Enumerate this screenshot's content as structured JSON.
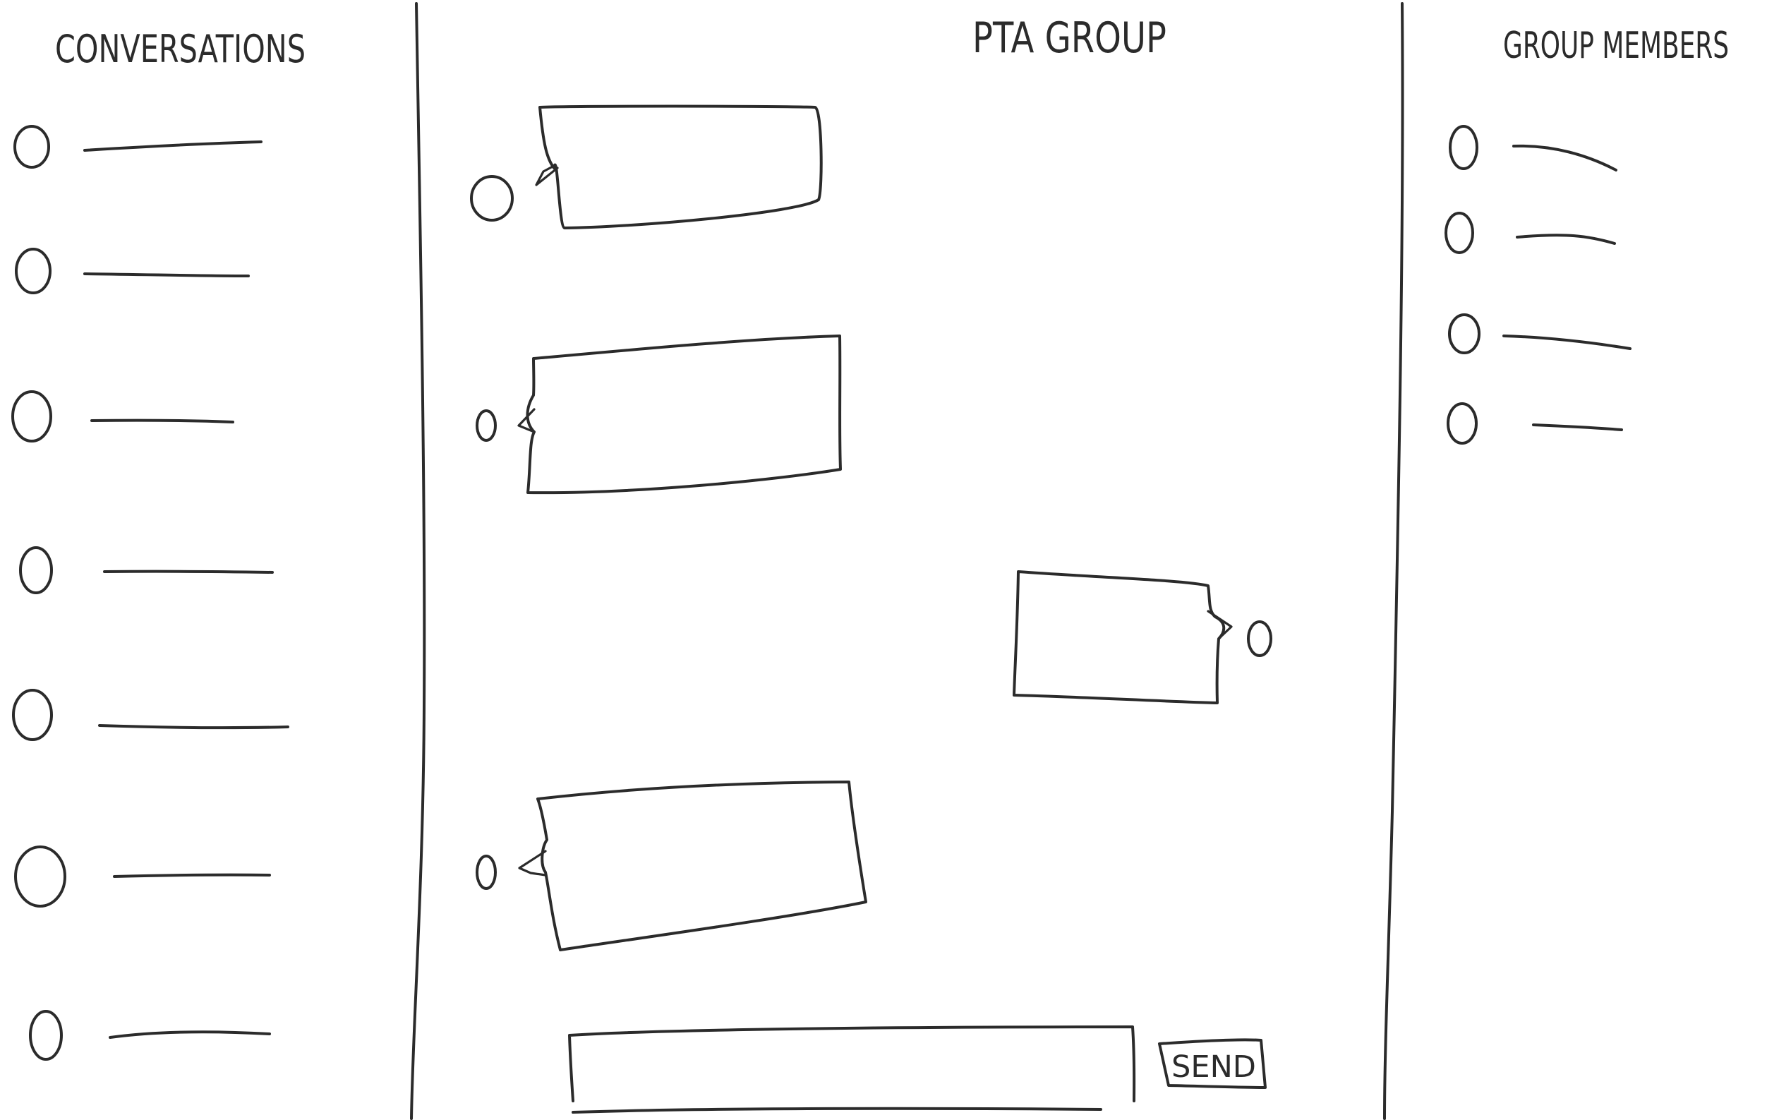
{
  "left_panel": {
    "title": "CONVERSATIONS",
    "items_count_visible": 7
  },
  "center_panel": {
    "title": "PTA GROUP",
    "send_label": "SEND"
  },
  "right_panel": {
    "title": "GROUP MEMBERS",
    "items_count_visible": 4
  }
}
